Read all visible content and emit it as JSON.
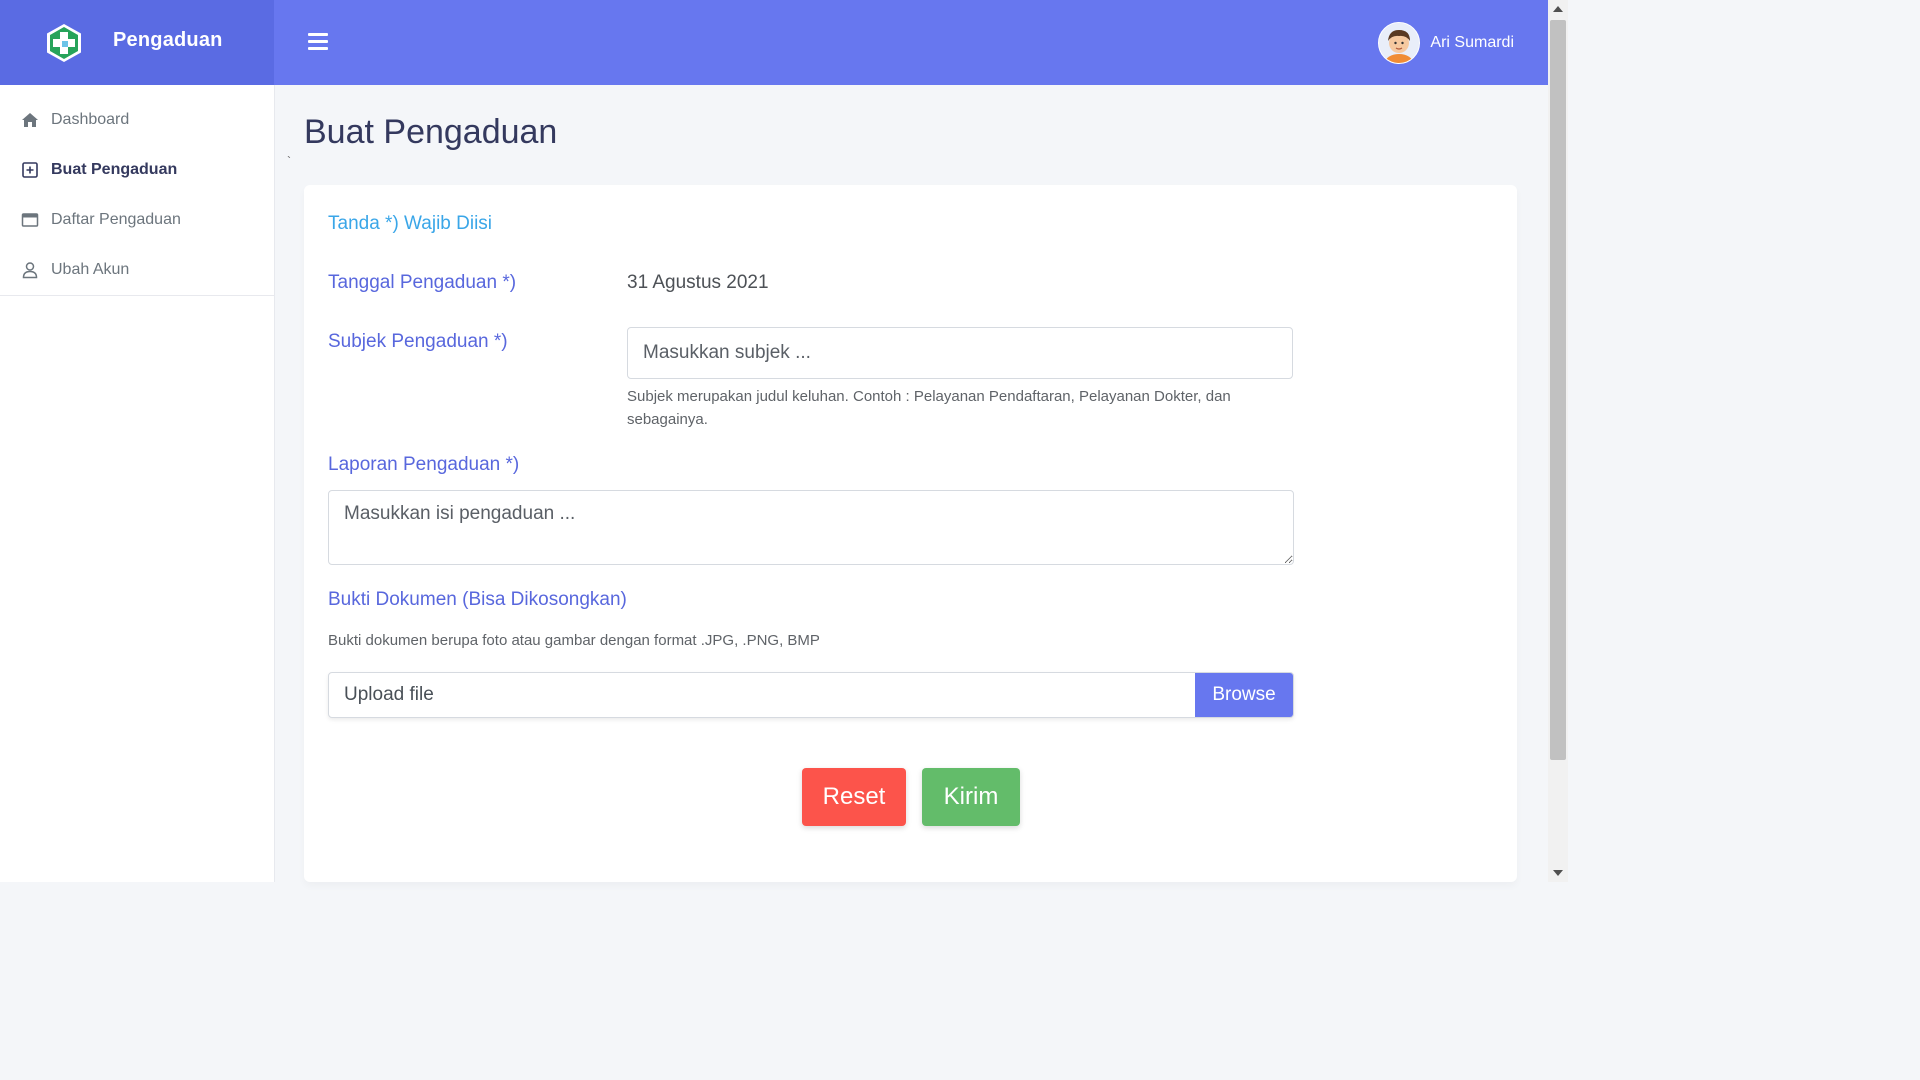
{
  "brand": {
    "name": "Pengaduan",
    "icon": "medical-cross-logo"
  },
  "topbar": {
    "menu_icon": "hamburger-icon",
    "user_name": "Ari Sumardi",
    "avatar": "user-avatar"
  },
  "sidebar": {
    "items": [
      {
        "label": "Dashboard",
        "icon": "home-icon",
        "active": false
      },
      {
        "label": "Buat Pengaduan",
        "icon": "plus-square-icon",
        "active": true
      },
      {
        "label": "Daftar Pengaduan",
        "icon": "window-icon",
        "active": false
      },
      {
        "label": "Ubah Akun",
        "icon": "user-icon",
        "active": false
      }
    ]
  },
  "page": {
    "title": "Buat Pengaduan",
    "stray_mark": "`"
  },
  "form": {
    "required_note": "Tanda *) Wajib Diisi",
    "date_label": "Tanggal Pengaduan *)",
    "date_value": "31 Agustus 2021",
    "subject_label": "Subjek Pengaduan *)",
    "subject_placeholder": "Masukkan subjek ...",
    "subject_help_line1": "Subjek merupakan judul keluhan. Contoh : Pelayanan Pendaftaran, Pelayanan Dokter, dan",
    "subject_help_line2": "sebagainya.",
    "report_label": "Laporan Pengaduan *)",
    "report_placeholder": "Masukkan isi pengaduan ...",
    "evidence_label": "Bukti Dokumen (Bisa Dikosongkan)",
    "evidence_help": "Bukti dokumen berupa foto atau gambar dengan format .JPG, .PNG, BMP",
    "file_placeholder": "Upload file",
    "browse_label": "Browse",
    "reset_label": "Reset",
    "submit_label": "Kirim"
  },
  "colors": {
    "topbar": "#6777ef",
    "brand_block": "#5a6be3",
    "label": "#5867dd",
    "note": "#3aa6e8",
    "reset": "#fc544b",
    "submit": "#63bc6a"
  }
}
